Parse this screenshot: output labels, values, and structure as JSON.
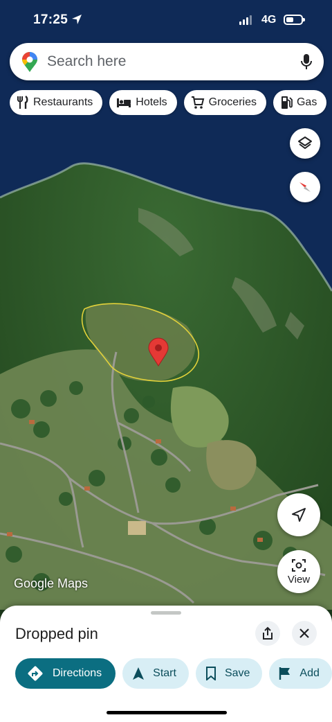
{
  "status_bar": {
    "time": "17:25",
    "network": "4G",
    "battery_level": 0.5
  },
  "search": {
    "placeholder": "Search here",
    "logo_icon": "google-maps-pin-icon",
    "mic_icon": "microphone-icon"
  },
  "chips": [
    {
      "label": "Restaurants",
      "icon": "fork-knife-icon"
    },
    {
      "label": "Hotels",
      "icon": "bed-icon"
    },
    {
      "label": "Groceries",
      "icon": "cart-icon"
    },
    {
      "label": "Gas",
      "icon": "fuel-pump-icon"
    }
  ],
  "map": {
    "layers_icon": "layers-icon",
    "compass_icon": "compass-icon",
    "my_location_icon": "navigation-arrow-icon",
    "view_label": "View",
    "watermark": "Google Maps",
    "colors": {
      "water": "#0f2a57",
      "forest": "#2e5a2a",
      "meadow": "#6e8a4e",
      "pin": "#e53935",
      "annotation": "#e3d23a"
    }
  },
  "place_sheet": {
    "title": "Dropped pin",
    "share_icon": "share-icon",
    "close_icon": "close-icon",
    "actions": [
      {
        "label": "Directions",
        "icon": "directions-icon"
      },
      {
        "label": "Start",
        "icon": "navigation-arrow-icon"
      },
      {
        "label": "Save",
        "icon": "bookmark-icon"
      },
      {
        "label": "Add",
        "icon": "flag-icon"
      }
    ],
    "colors": {
      "primary": "#0b6e81",
      "secondary": "#d8eef5"
    }
  }
}
